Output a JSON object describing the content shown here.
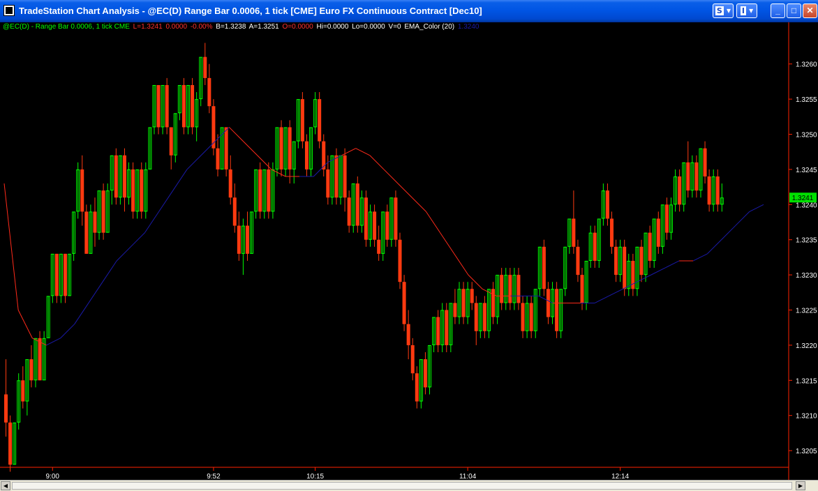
{
  "window": {
    "title": "TradeStation Chart Analysis - @EC(D) Range Bar 0.0006, 1 tick [CME] Euro FX Continuous Contract [Dec10]",
    "btn_s": "S",
    "btn_i": "I",
    "btn_arrow": "▾",
    "btn_minimize": "_",
    "btn_maximize": "□",
    "btn_close": "✕"
  },
  "info_bar": {
    "symbol": "@EC(D) - Range Bar 0.0006, 1 tick  CME",
    "last": "L=1.3241",
    "net": "0.0000",
    "pct": "-0.00%",
    "bid": "B=1.3238",
    "ask": "A=1.3251",
    "open": "O=0.0000",
    "high": "Hi=0.0000",
    "low": "Lo=0.0000",
    "volume": "V=0",
    "indicator": "EMA_Color (20)",
    "indicator_value": "1.3240"
  },
  "colors": {
    "up": "#00ff00",
    "down": "#ff3a10",
    "ema_above": "#ff2a1a",
    "ema_below": "#1a1aa8",
    "axis": "#ff2200",
    "label_bg": "#00e000",
    "symbol": "#00ff00",
    "last": "#ff3030",
    "bid_ask": "#ffffff",
    "ohlc": "#ff3030",
    "ema_value": "#1a1aa8"
  },
  "chart_data": {
    "type": "candlestick",
    "y_ticks": [
      "1.3260",
      "1.3255",
      "1.3250",
      "1.3245",
      "1.3240",
      "1.3235",
      "1.3230",
      "1.3225",
      "1.3220",
      "1.3215",
      "1.3210",
      "1.3205"
    ],
    "ylim": [
      1.3202,
      1.3265
    ],
    "x_ticks": [
      {
        "label": "9:00",
        "bar": 11
      },
      {
        "label": "9:52",
        "bar": 49
      },
      {
        "label": "10:15",
        "bar": 73
      },
      {
        "label": "11:04",
        "bar": 109
      },
      {
        "label": "12:14",
        "bar": 145
      }
    ],
    "last_price_label": "1.3241",
    "last_price": 1.3241,
    "bars": [
      [
        1.3213,
        1.3209,
        1.3218,
        1.3207,
        1
      ],
      [
        1.3209,
        1.3203,
        1.321,
        1.3202,
        1
      ],
      [
        1.3203,
        1.3209,
        1.3209,
        1.3203,
        0
      ],
      [
        1.3209,
        1.3215,
        1.3216,
        1.3208,
        0
      ],
      [
        1.3215,
        1.3212,
        1.3217,
        1.3211,
        1
      ],
      [
        1.3212,
        1.3218,
        1.3218,
        1.321,
        0
      ],
      [
        1.3218,
        1.3215,
        1.322,
        1.3214,
        1
      ],
      [
        1.3215,
        1.3221,
        1.3221,
        1.3214,
        0
      ],
      [
        1.3221,
        1.3215,
        1.3222,
        1.3215,
        1
      ],
      [
        1.3215,
        1.3221,
        1.3222,
        1.3215,
        0
      ],
      [
        1.3221,
        1.3227,
        1.3227,
        1.3221,
        0
      ],
      [
        1.3227,
        1.3233,
        1.3233,
        1.3226,
        0
      ],
      [
        1.3233,
        1.3227,
        1.3233,
        1.3226,
        1
      ],
      [
        1.3227,
        1.3233,
        1.3233,
        1.3226,
        0
      ],
      [
        1.3233,
        1.3227,
        1.3233,
        1.3226,
        1
      ],
      [
        1.3227,
        1.3233,
        1.3233,
        1.3227,
        0
      ],
      [
        1.3233,
        1.3239,
        1.3239,
        1.3232,
        0
      ],
      [
        1.3239,
        1.3245,
        1.3246,
        1.3238,
        0
      ],
      [
        1.3245,
        1.3239,
        1.3247,
        1.3237,
        1
      ],
      [
        1.3239,
        1.3233,
        1.324,
        1.3233,
        1
      ],
      [
        1.3233,
        1.3239,
        1.324,
        1.3233,
        0
      ],
      [
        1.3239,
        1.3236,
        1.3241,
        1.3234,
        1
      ],
      [
        1.3236,
        1.3242,
        1.3242,
        1.3235,
        0
      ],
      [
        1.3242,
        1.3236,
        1.3243,
        1.3235,
        1
      ],
      [
        1.3236,
        1.3242,
        1.3243,
        1.3236,
        0
      ],
      [
        1.3242,
        1.3247,
        1.3247,
        1.324,
        0
      ],
      [
        1.3247,
        1.3241,
        1.3248,
        1.324,
        1
      ],
      [
        1.3241,
        1.3247,
        1.3247,
        1.324,
        0
      ],
      [
        1.3247,
        1.3241,
        1.3248,
        1.3239,
        1
      ],
      [
        1.3241,
        1.3245,
        1.3246,
        1.324,
        0
      ],
      [
        1.3245,
        1.3239,
        1.3246,
        1.3238,
        1
      ],
      [
        1.3239,
        1.3245,
        1.3245,
        1.3238,
        0
      ],
      [
        1.3245,
        1.3239,
        1.3246,
        1.3238,
        1
      ],
      [
        1.3239,
        1.3245,
        1.3246,
        1.3238,
        0
      ],
      [
        1.3245,
        1.3251,
        1.3251,
        1.3245,
        0
      ],
      [
        1.3251,
        1.3257,
        1.3257,
        1.325,
        0
      ],
      [
        1.3257,
        1.3251,
        1.3257,
        1.325,
        1
      ],
      [
        1.3251,
        1.3257,
        1.3257,
        1.325,
        0
      ],
      [
        1.3257,
        1.3251,
        1.3258,
        1.325,
        1
      ],
      [
        1.3251,
        1.3247,
        1.3251,
        1.3245,
        1
      ],
      [
        1.3247,
        1.3253,
        1.3253,
        1.3246,
        0
      ],
      [
        1.3253,
        1.3257,
        1.3257,
        1.3252,
        0
      ],
      [
        1.3257,
        1.3251,
        1.3258,
        1.325,
        1
      ],
      [
        1.3251,
        1.3257,
        1.3257,
        1.325,
        0
      ],
      [
        1.3257,
        1.3251,
        1.3258,
        1.325,
        1
      ],
      [
        1.3251,
        1.3255,
        1.3256,
        1.3249,
        0
      ],
      [
        1.3255,
        1.3261,
        1.3261,
        1.3254,
        0
      ],
      [
        1.3261,
        1.3258,
        1.3263,
        1.3257,
        1
      ],
      [
        1.3258,
        1.3254,
        1.326,
        1.3253,
        1
      ],
      [
        1.3254,
        1.3248,
        1.3255,
        1.3247,
        1
      ],
      [
        1.3248,
        1.3245,
        1.325,
        1.3244,
        1
      ],
      [
        1.3245,
        1.3251,
        1.3251,
        1.3245,
        0
      ],
      [
        1.3251,
        1.3245,
        1.3251,
        1.3244,
        1
      ],
      [
        1.3245,
        1.3241,
        1.3247,
        1.324,
        1
      ],
      [
        1.3241,
        1.3237,
        1.3243,
        1.3236,
        1
      ],
      [
        1.3237,
        1.3233,
        1.3239,
        1.3232,
        1
      ],
      [
        1.3233,
        1.3237,
        1.3238,
        1.323,
        0
      ],
      [
        1.3237,
        1.3233,
        1.3239,
        1.3232,
        1
      ],
      [
        1.3233,
        1.3239,
        1.3239,
        1.3233,
        0
      ],
      [
        1.3239,
        1.3245,
        1.3245,
        1.3238,
        0
      ],
      [
        1.3245,
        1.3239,
        1.3246,
        1.3238,
        1
      ],
      [
        1.3239,
        1.3245,
        1.3245,
        1.3238,
        0
      ],
      [
        1.3245,
        1.3239,
        1.3246,
        1.3238,
        1
      ],
      [
        1.3239,
        1.3245,
        1.3246,
        1.3238,
        0
      ],
      [
        1.3245,
        1.3251,
        1.3251,
        1.3244,
        0
      ],
      [
        1.3251,
        1.3245,
        1.3252,
        1.3244,
        1
      ],
      [
        1.3245,
        1.3251,
        1.3251,
        1.3244,
        0
      ],
      [
        1.3251,
        1.3245,
        1.3252,
        1.3243,
        1
      ],
      [
        1.3245,
        1.3249,
        1.3249,
        1.3243,
        0
      ],
      [
        1.3249,
        1.3255,
        1.3255,
        1.3248,
        0
      ],
      [
        1.3255,
        1.3249,
        1.3256,
        1.3248,
        1
      ],
      [
        1.3249,
        1.3245,
        1.325,
        1.3244,
        1
      ],
      [
        1.3245,
        1.3251,
        1.3251,
        1.3244,
        0
      ],
      [
        1.3251,
        1.3255,
        1.3256,
        1.325,
        0
      ],
      [
        1.3255,
        1.3249,
        1.3256,
        1.3248,
        1
      ],
      [
        1.3249,
        1.3245,
        1.325,
        1.3244,
        1
      ],
      [
        1.3245,
        1.3241,
        1.3247,
        1.324,
        1
      ],
      [
        1.3241,
        1.3247,
        1.3247,
        1.324,
        0
      ],
      [
        1.3247,
        1.3241,
        1.3248,
        1.324,
        1
      ],
      [
        1.3241,
        1.3247,
        1.3247,
        1.324,
        0
      ],
      [
        1.3247,
        1.3241,
        1.3248,
        1.3239,
        1
      ],
      [
        1.3241,
        1.3237,
        1.3242,
        1.3236,
        1
      ],
      [
        1.3237,
        1.3243,
        1.3243,
        1.3236,
        0
      ],
      [
        1.3243,
        1.3237,
        1.3244,
        1.3236,
        1
      ],
      [
        1.3237,
        1.3241,
        1.3242,
        1.3236,
        0
      ],
      [
        1.3241,
        1.3235,
        1.3242,
        1.3234,
        1
      ],
      [
        1.3235,
        1.3239,
        1.324,
        1.3234,
        0
      ],
      [
        1.3239,
        1.3235,
        1.324,
        1.3234,
        1
      ],
      [
        1.3235,
        1.3233,
        1.3237,
        1.3232,
        1
      ],
      [
        1.3233,
        1.3239,
        1.3239,
        1.3232,
        0
      ],
      [
        1.3239,
        1.3235,
        1.324,
        1.3234,
        1
      ],
      [
        1.3235,
        1.3241,
        1.3241,
        1.3234,
        0
      ],
      [
        1.3241,
        1.3235,
        1.3242,
        1.3234,
        1
      ],
      [
        1.3235,
        1.3229,
        1.3236,
        1.3228,
        1
      ],
      [
        1.3229,
        1.3223,
        1.323,
        1.3222,
        1
      ],
      [
        1.3223,
        1.322,
        1.3225,
        1.3218,
        1
      ],
      [
        1.322,
        1.3216,
        1.3221,
        1.3215,
        1
      ],
      [
        1.3216,
        1.3212,
        1.3217,
        1.3211,
        1
      ],
      [
        1.3212,
        1.3218,
        1.3218,
        1.3211,
        0
      ],
      [
        1.3218,
        1.3214,
        1.3219,
        1.3213,
        1
      ],
      [
        1.3214,
        1.322,
        1.322,
        1.3213,
        0
      ],
      [
        1.322,
        1.3224,
        1.3224,
        1.3219,
        0
      ],
      [
        1.3224,
        1.322,
        1.3225,
        1.3219,
        1
      ],
      [
        1.322,
        1.3225,
        1.3226,
        1.3219,
        0
      ],
      [
        1.3225,
        1.322,
        1.3226,
        1.3219,
        1
      ],
      [
        1.322,
        1.3226,
        1.3226,
        1.3219,
        0
      ],
      [
        1.3226,
        1.3224,
        1.3228,
        1.3223,
        1
      ],
      [
        1.3224,
        1.3228,
        1.3229,
        1.3223,
        0
      ],
      [
        1.3228,
        1.3224,
        1.3229,
        1.3223,
        1
      ],
      [
        1.3224,
        1.3228,
        1.3229,
        1.3223,
        0
      ],
      [
        1.3228,
        1.3226,
        1.3229,
        1.3225,
        1
      ],
      [
        1.3226,
        1.3222,
        1.3227,
        1.322,
        1
      ],
      [
        1.3222,
        1.3226,
        1.3226,
        1.3221,
        0
      ],
      [
        1.3226,
        1.3222,
        1.3227,
        1.3221,
        1
      ],
      [
        1.3222,
        1.3228,
        1.3228,
        1.3221,
        0
      ],
      [
        1.3228,
        1.3224,
        1.3229,
        1.3223,
        1
      ],
      [
        1.3224,
        1.323,
        1.323,
        1.3223,
        0
      ],
      [
        1.323,
        1.3226,
        1.3231,
        1.3225,
        1
      ],
      [
        1.3226,
        1.323,
        1.3231,
        1.3225,
        0
      ],
      [
        1.323,
        1.3226,
        1.3231,
        1.3225,
        1
      ],
      [
        1.3226,
        1.323,
        1.3231,
        1.3225,
        0
      ],
      [
        1.323,
        1.3226,
        1.3231,
        1.3225,
        1
      ],
      [
        1.3226,
        1.3222,
        1.3227,
        1.3221,
        1
      ],
      [
        1.3222,
        1.3226,
        1.3227,
        1.3221,
        0
      ],
      [
        1.3226,
        1.3222,
        1.3227,
        1.3221,
        1
      ],
      [
        1.3222,
        1.3228,
        1.3228,
        1.3221,
        0
      ],
      [
        1.3228,
        1.3234,
        1.3234,
        1.3227,
        0
      ],
      [
        1.3234,
        1.3228,
        1.3235,
        1.3227,
        1
      ],
      [
        1.3228,
        1.3224,
        1.3229,
        1.3223,
        1
      ],
      [
        1.3224,
        1.3228,
        1.3229,
        1.3223,
        0
      ],
      [
        1.3228,
        1.3222,
        1.3229,
        1.3221,
        1
      ],
      [
        1.3222,
        1.3228,
        1.3228,
        1.3221,
        0
      ],
      [
        1.3228,
        1.3234,
        1.3234,
        1.3227,
        0
      ],
      [
        1.3234,
        1.3238,
        1.3238,
        1.3233,
        0
      ],
      [
        1.3238,
        1.3234,
        1.3242,
        1.3233,
        1
      ],
      [
        1.3234,
        1.323,
        1.3235,
        1.3229,
        1
      ],
      [
        1.323,
        1.3226,
        1.3231,
        1.3225,
        1
      ],
      [
        1.3226,
        1.3232,
        1.3232,
        1.3225,
        0
      ],
      [
        1.3232,
        1.3236,
        1.3237,
        1.3231,
        0
      ],
      [
        1.3236,
        1.3232,
        1.3237,
        1.3231,
        1
      ],
      [
        1.3232,
        1.3238,
        1.3238,
        1.3231,
        0
      ],
      [
        1.3238,
        1.3242,
        1.3243,
        1.3237,
        0
      ],
      [
        1.3242,
        1.3238,
        1.3243,
        1.3237,
        1
      ],
      [
        1.3238,
        1.3234,
        1.3239,
        1.3233,
        1
      ],
      [
        1.3234,
        1.323,
        1.3235,
        1.3229,
        1
      ],
      [
        1.323,
        1.3234,
        1.3235,
        1.3229,
        0
      ],
      [
        1.3234,
        1.3228,
        1.3235,
        1.3227,
        1
      ],
      [
        1.3228,
        1.3232,
        1.3233,
        1.3227,
        0
      ],
      [
        1.3232,
        1.3228,
        1.3233,
        1.3227,
        1
      ],
      [
        1.3228,
        1.3234,
        1.3234,
        1.3227,
        0
      ],
      [
        1.3234,
        1.323,
        1.3235,
        1.3229,
        1
      ],
      [
        1.323,
        1.3236,
        1.3236,
        1.3229,
        0
      ],
      [
        1.3236,
        1.3232,
        1.3237,
        1.3231,
        1
      ],
      [
        1.3232,
        1.3238,
        1.3238,
        1.3231,
        0
      ],
      [
        1.3238,
        1.3234,
        1.3239,
        1.3233,
        1
      ],
      [
        1.3234,
        1.324,
        1.324,
        1.3233,
        0
      ],
      [
        1.324,
        1.3236,
        1.3241,
        1.3235,
        1
      ],
      [
        1.3236,
        1.324,
        1.3241,
        1.3235,
        0
      ],
      [
        1.324,
        1.3244,
        1.3245,
        1.3239,
        0
      ],
      [
        1.3244,
        1.324,
        1.3245,
        1.3239,
        1
      ],
      [
        1.324,
        1.3246,
        1.3246,
        1.3239,
        0
      ],
      [
        1.3246,
        1.3242,
        1.3249,
        1.3241,
        1
      ],
      [
        1.3242,
        1.3246,
        1.3247,
        1.3241,
        0
      ],
      [
        1.3246,
        1.3242,
        1.3247,
        1.3241,
        1
      ],
      [
        1.3242,
        1.3248,
        1.3248,
        1.3241,
        0
      ],
      [
        1.3248,
        1.3244,
        1.3249,
        1.3243,
        1
      ],
      [
        1.3244,
        1.324,
        1.3245,
        1.3239,
        1
      ],
      [
        1.324,
        1.3244,
        1.3245,
        1.3239,
        0
      ],
      [
        1.3244,
        1.324,
        1.3245,
        1.3239,
        1
      ],
      [
        1.324,
        1.3241,
        1.3243,
        1.3239,
        0
      ]
    ],
    "ema": [
      [
        1.3243,
        1
      ],
      [
        1.3225,
        1
      ],
      [
        1.3221,
        1
      ],
      [
        1.322,
        1
      ],
      [
        1.3221,
        0
      ],
      [
        1.3223,
        0
      ],
      [
        1.3226,
        0
      ],
      [
        1.3229,
        0
      ],
      [
        1.3232,
        0
      ],
      [
        1.3234,
        0
      ],
      [
        1.3236,
        0
      ],
      [
        1.3239,
        0
      ],
      [
        1.3242,
        0
      ],
      [
        1.3245,
        0
      ],
      [
        1.3247,
        0
      ],
      [
        1.3249,
        0
      ],
      [
        1.3251,
        0
      ],
      [
        1.3249,
        1
      ],
      [
        1.3247,
        1
      ],
      [
        1.3245,
        1
      ],
      [
        1.3244,
        1
      ],
      [
        1.3244,
        1
      ],
      [
        1.3244,
        0
      ],
      [
        1.3246,
        0
      ],
      [
        1.3247,
        0
      ],
      [
        1.3248,
        1
      ],
      [
        1.3247,
        1
      ],
      [
        1.3245,
        1
      ],
      [
        1.3243,
        1
      ],
      [
        1.3241,
        1
      ],
      [
        1.3239,
        1
      ],
      [
        1.3236,
        1
      ],
      [
        1.3233,
        1
      ],
      [
        1.323,
        1
      ],
      [
        1.3228,
        1
      ],
      [
        1.3227,
        1
      ],
      [
        1.3227,
        1
      ],
      [
        1.3227,
        0
      ],
      [
        1.3227,
        0
      ],
      [
        1.3226,
        0
      ],
      [
        1.3226,
        1
      ],
      [
        1.3226,
        1
      ],
      [
        1.3226,
        0
      ],
      [
        1.3227,
        0
      ],
      [
        1.3228,
        0
      ],
      [
        1.3229,
        0
      ],
      [
        1.323,
        0
      ],
      [
        1.3231,
        0
      ],
      [
        1.3232,
        0
      ],
      [
        1.3232,
        1
      ],
      [
        1.3233,
        0
      ],
      [
        1.3235,
        0
      ],
      [
        1.3237,
        0
      ],
      [
        1.3239,
        0
      ],
      [
        1.324,
        0
      ]
    ]
  }
}
